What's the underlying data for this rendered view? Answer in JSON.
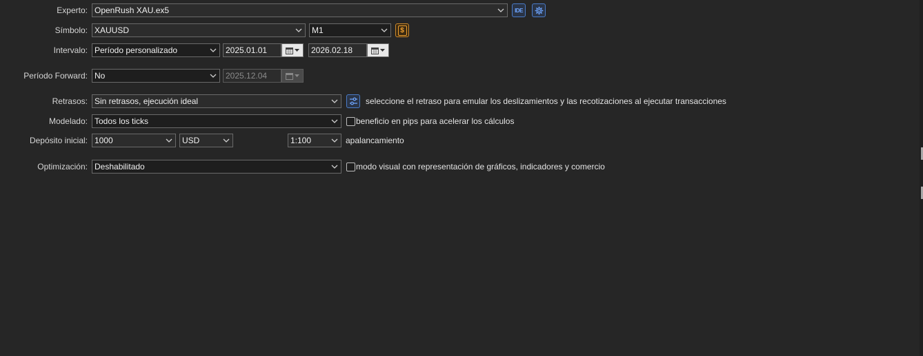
{
  "labels": {
    "expert": "Experto:",
    "symbol": "Símbolo:",
    "interval": "Intervalo:",
    "forward": "Período Forward:",
    "delays": "Retrasos:",
    "modeling": "Modelado:",
    "deposit": "Depósito inicial:",
    "optimization": "Optimización:"
  },
  "expert": {
    "value": "OpenRush XAU.ex5",
    "ide_label": "IDE"
  },
  "symbol": {
    "value": "XAUUSD",
    "timeframe": "M1",
    "coin_label": "$"
  },
  "interval": {
    "value": "Período personalizado",
    "from": "2025.01.01",
    "to": "2026.02.18"
  },
  "forward": {
    "value": "No",
    "date": "2025.12.04"
  },
  "delays": {
    "value": "Sin retrasos, ejecución ideal",
    "hint": "seleccione el retraso para emular los deslizamientos y las recotizaciones al ejecutar transacciones"
  },
  "modeling": {
    "value": "Todos los ticks",
    "checkbox_label": "beneficio en pips para acelerar los cálculos"
  },
  "deposit": {
    "value": "1000",
    "currency": "USD",
    "leverage": "1:100",
    "leverage_label": "apalancamiento"
  },
  "optimization": {
    "value": "Deshabilitado",
    "checkbox_label": "modo visual con representación de gráficos, indicadores y comercio"
  },
  "colors": {
    "background": "#262626",
    "accent_blue": "#4a7cc9",
    "accent_gold": "#d08a2a"
  }
}
